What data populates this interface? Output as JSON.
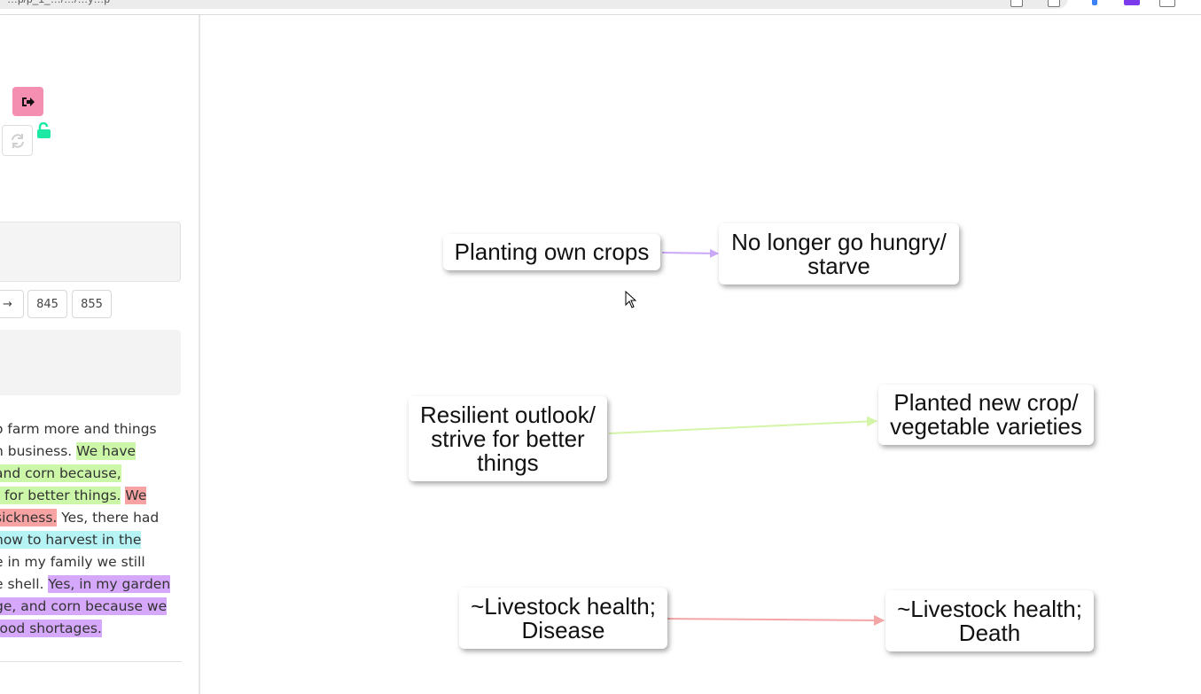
{
  "browser": {
    "url_fragment": "…p/p_1_…/…/…y…p"
  },
  "sidebar": {
    "logout_icon": "sign-out-icon",
    "refresh_icon": "refresh-icon",
    "lock_icon": "unlock-icon",
    "pagination": {
      "next_arrow": "→",
      "pages": [
        "845",
        "855"
      ]
    },
    "transcript_lines": [
      [
        {
          "t": "o farm more and things",
          "c": ""
        }
      ],
      [
        {
          "t": "n business. ",
          "c": ""
        },
        {
          "t": "We have",
          "c": "green"
        }
      ],
      [
        {
          "t": " and corn because,",
          "c": "green"
        }
      ],
      [
        {
          "t": "t for better things.",
          "c": "green"
        },
        {
          "t": " ",
          "c": ""
        },
        {
          "t": "We",
          "c": "red"
        }
      ],
      [
        {
          "t": "sickness.",
          "c": "red"
        },
        {
          "t": " Yes, there had",
          "c": ""
        }
      ],
      [
        {
          "t": " how to harvest in the",
          "c": "cyan"
        }
      ],
      [
        {
          "t": "e in my family we still",
          "c": ""
        }
      ],
      [
        {
          "t": "e shell. ",
          "c": ""
        },
        {
          "t": "Yes, in my garden",
          "c": "purple"
        }
      ],
      [
        {
          "t": "ge, and corn because we",
          "c": "purple"
        }
      ],
      [
        {
          "t": " food shortages.",
          "c": "purple"
        }
      ]
    ]
  },
  "colors": {
    "logout_button": "#f48fb1",
    "lock": "#1de9a4",
    "green": "#ccf7a8",
    "red": "#f7a3a3",
    "cyan": "#b5f3f5",
    "purple": "#d5a8fb",
    "edge_purple": "#c9a8f8",
    "edge_green": "#d4f5a8",
    "edge_red": "#f4a6a6"
  },
  "canvas": {
    "nodes": {
      "n1": "Planting own crops",
      "n2": "No longer go hungry/\nstarve",
      "n3": "Resilient outlook/\nstrive for better\nthings",
      "n4": "Planted new crop/\nvegetable varieties",
      "n5": "~Livestock health;\nDisease",
      "n6": "~Livestock health;\nDeath"
    }
  }
}
